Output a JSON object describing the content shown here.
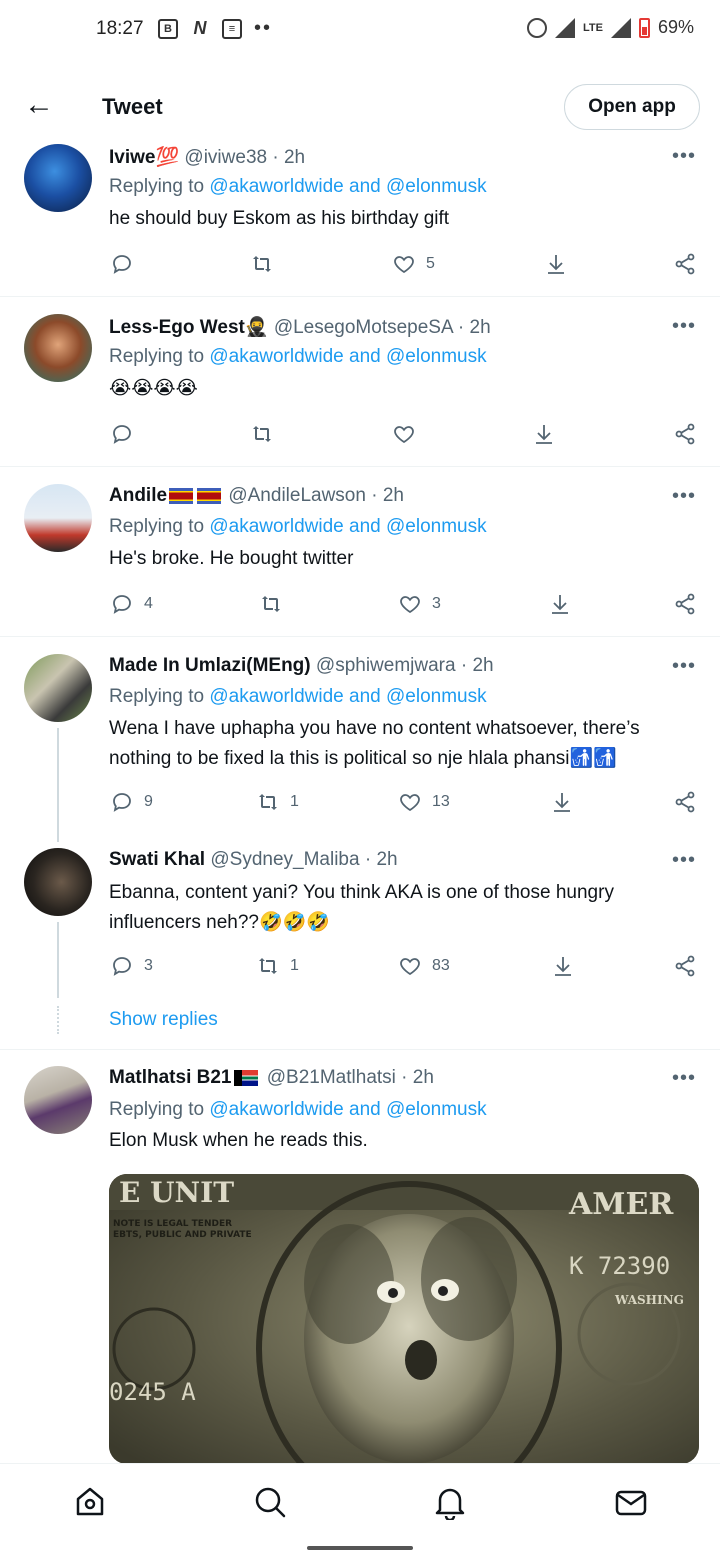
{
  "status_bar": {
    "time": "18:27",
    "network": "LTE",
    "battery": "69%",
    "battery_color": "#e53935"
  },
  "header": {
    "title": "Tweet",
    "open_app_label": "Open app"
  },
  "colors": {
    "accent": "#1d9bf0",
    "secondary_text": "#536471"
  },
  "tweets": [
    {
      "name": "Iviwe💯",
      "handle": "@iviwe38",
      "time": "· 2h",
      "replying_prefix": "Replying to ",
      "replying_to": "@akaworldwide and @elonmusk",
      "text": "he should buy Eskom as his birthday gift",
      "replies": "",
      "retweets": "",
      "likes": "5"
    },
    {
      "name": "Less-Ego West",
      "handle": "@LesegoMotsepeSA",
      "time": "· 2h",
      "replying_prefix": "Replying to ",
      "replying_to": "@akaworldwide and @elonmusk",
      "text": "😭😭😭😭",
      "replies": "",
      "retweets": "",
      "likes": ""
    },
    {
      "name": "Andile",
      "handle": "@AndileLawson",
      "time": "· 2h",
      "replying_prefix": "Replying to ",
      "replying_to": "@akaworldwide and @elonmusk",
      "text": "He's broke. He bought twitter",
      "replies": "4",
      "retweets": "",
      "likes": "3"
    },
    {
      "name": "Made In Umlazi(MEng)",
      "handle": "@sphiwemjwara",
      "time": "· 2h",
      "replying_prefix": "Replying to ",
      "replying_to": "@akaworldwide and @elonmusk",
      "text": "Wena I have uphapha you have no content whatsoever, there’s nothing to be fixed la this is political so nje hlala phansi🚮🚮",
      "replies": "9",
      "retweets": "1",
      "likes": "13"
    },
    {
      "name": "Swati Khal",
      "handle": "@Sydney_Maliba",
      "time": "· 2h",
      "text": "Ebanna, content yani? You think AKA is one of those hungry influencers neh??🤣🤣🤣",
      "replies": "3",
      "retweets": "1",
      "likes": "83"
    },
    {
      "name": "Matlhatsi B21",
      "handle": "@B21Matlhatsi",
      "time": "· 2h",
      "replying_prefix": "Replying to ",
      "replying_to": "@akaworldwide and @elonmusk",
      "text": "Elon Musk when he reads this."
    }
  ],
  "show_replies_label": "Show replies",
  "media_bill_text": {
    "top_left": "E UNIT",
    "top_right": "AMER",
    "note_line1": "NOTE IS LEGAL TENDER",
    "note_line2": "EBTS, PUBLIC AND PRIVATE",
    "serial": "K 72390",
    "washington": "WASHING",
    "bottom_serial": "0245 A"
  },
  "nav": [
    "home-icon",
    "search-icon",
    "notifications-icon",
    "messages-icon"
  ]
}
